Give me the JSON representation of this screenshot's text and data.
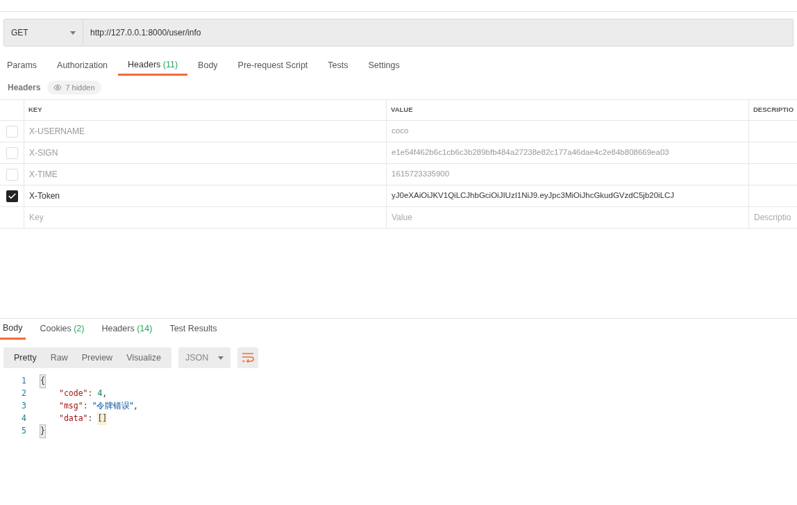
{
  "request": {
    "method": "GET",
    "url": "http://127.0.0.1:8000/user/info"
  },
  "request_tabs": [
    {
      "label": "Params",
      "selected": false
    },
    {
      "label": "Authorization",
      "selected": false
    },
    {
      "label": "Headers",
      "count": "(11)",
      "selected": true
    },
    {
      "label": "Body",
      "selected": false
    },
    {
      "label": "Pre-request Script",
      "selected": false
    },
    {
      "label": "Tests",
      "selected": false
    },
    {
      "label": "Settings",
      "selected": false
    }
  ],
  "headers_bar": {
    "label": "Headers",
    "hidden_badge": "7 hidden"
  },
  "table": {
    "columns": [
      "KEY",
      "VALUE",
      "DESCRIPTIO"
    ],
    "rows": [
      {
        "checked": false,
        "key": "X-USERNAME",
        "value": "coco"
      },
      {
        "checked": false,
        "key": "X-SIGN",
        "value": "e1e54f462b6c1cb6c3b289bfb484a27238e82c177a46dae4c2e84b808669ea03"
      },
      {
        "checked": false,
        "key": "X-TIME",
        "value": "1615723335900"
      },
      {
        "checked": true,
        "key": "X-Token",
        "value": "yJ0eXAiOiJKV1QiLCJhbGciOiJIUzI1NiJ9.eyJpc3MiOiJhcGkudGVzdC5jb20iLCJ"
      }
    ],
    "new_row": {
      "key_placeholder": "Key",
      "value_placeholder": "Value",
      "description_placeholder": "Descriptio"
    }
  },
  "response_tabs": [
    {
      "label": "Body",
      "selected": true
    },
    {
      "label": "Cookies",
      "count": "(2)",
      "selected": false
    },
    {
      "label": "Headers",
      "count": "(14)",
      "selected": false
    },
    {
      "label": "Test Results",
      "selected": false
    }
  ],
  "view_modes": [
    {
      "label": "Pretty",
      "selected": true
    },
    {
      "label": "Raw",
      "selected": false
    },
    {
      "label": "Preview",
      "selected": false
    },
    {
      "label": "Visualize",
      "selected": false
    }
  ],
  "format": "JSON",
  "code_lines": [
    {
      "number": "1",
      "tokens": [
        {
          "kind": "brace",
          "text": "{"
        }
      ]
    },
    {
      "number": "2",
      "tokens": [
        {
          "kind": "key",
          "text": "\"code\""
        },
        {
          "kind": "punct",
          "text": ": "
        },
        {
          "kind": "number",
          "text": "4"
        },
        {
          "kind": "punct",
          "text": ","
        }
      ]
    },
    {
      "number": "3",
      "tokens": [
        {
          "kind": "key",
          "text": "\"msg\""
        },
        {
          "kind": "punct",
          "text": ": "
        },
        {
          "kind": "string",
          "text": "\"令牌错误\""
        },
        {
          "kind": "punct",
          "text": ","
        }
      ]
    },
    {
      "number": "4",
      "tokens": [
        {
          "kind": "key",
          "text": "\"data\""
        },
        {
          "kind": "punct",
          "text": ": "
        },
        {
          "kind": "bracket",
          "text": "[]"
        }
      ]
    },
    {
      "number": "5",
      "tokens": [
        {
          "kind": "brace",
          "text": "}"
        }
      ]
    }
  ]
}
